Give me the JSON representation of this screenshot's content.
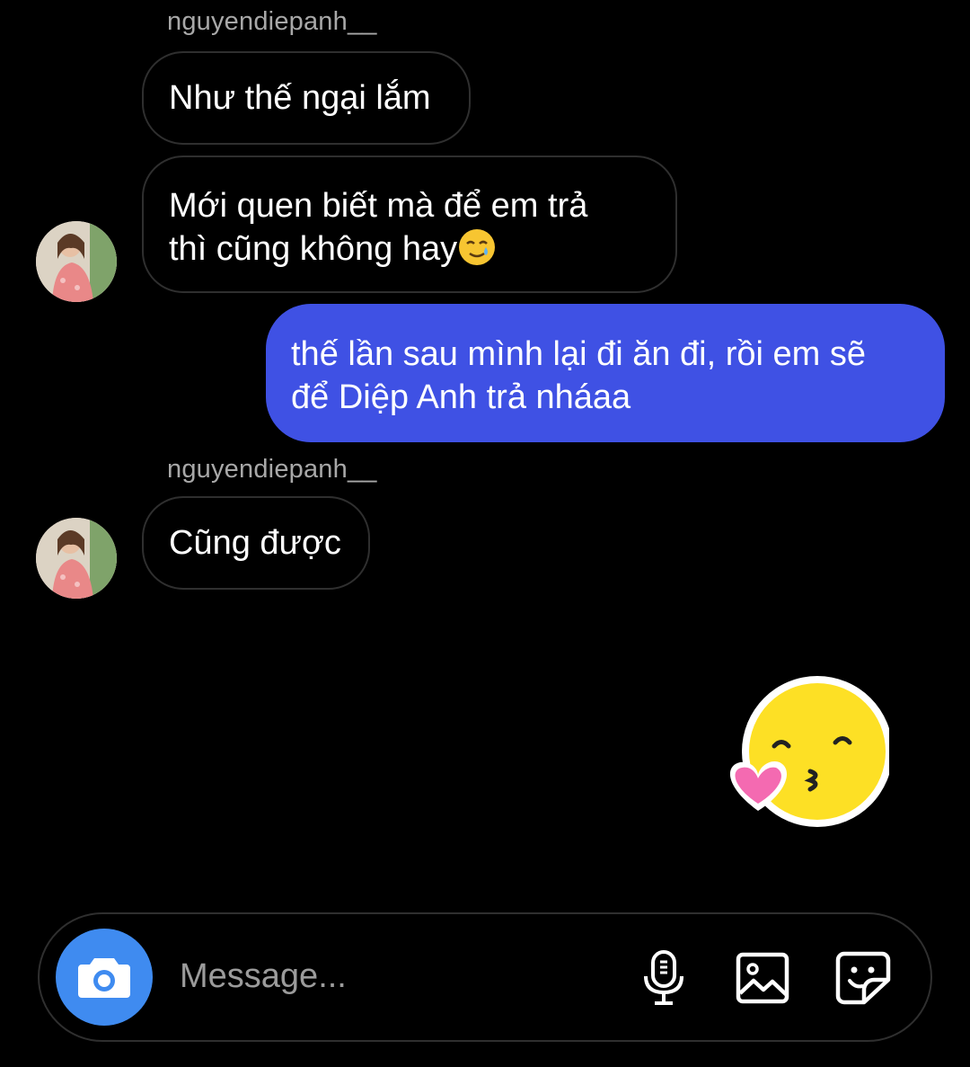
{
  "messages": [
    {
      "sender": "nguyendiepanh__"
    },
    {
      "text": "Như thế ngại lắm"
    },
    {
      "text_line1": "Mới quen biết mà để em trả",
      "text_line2": "thì cũng không hay",
      "emoji": "smiling-face-with-tear"
    },
    {
      "text_line1": "thế lần sau mình lại đi ăn đi, rồi em sẽ",
      "text_line2": "để Diệp Anh trả nháaa"
    },
    {
      "sender": "nguyendiepanh__"
    },
    {
      "text": "Cũng được"
    },
    {
      "sticker": "kissing-face-with-heart-sticker"
    }
  ],
  "composer": {
    "placeholder": "Message...",
    "camera_icon": "camera-icon",
    "mic_icon": "microphone-icon",
    "gallery_icon": "image-icon",
    "sticker_icon": "sticker-icon"
  },
  "colors": {
    "background": "#000000",
    "outgoing_bubble": "#3f51e4",
    "incoming_border": "#2f2f2f",
    "camera_button": "#3f8bf0",
    "sender_name": "#a8a8a8"
  }
}
